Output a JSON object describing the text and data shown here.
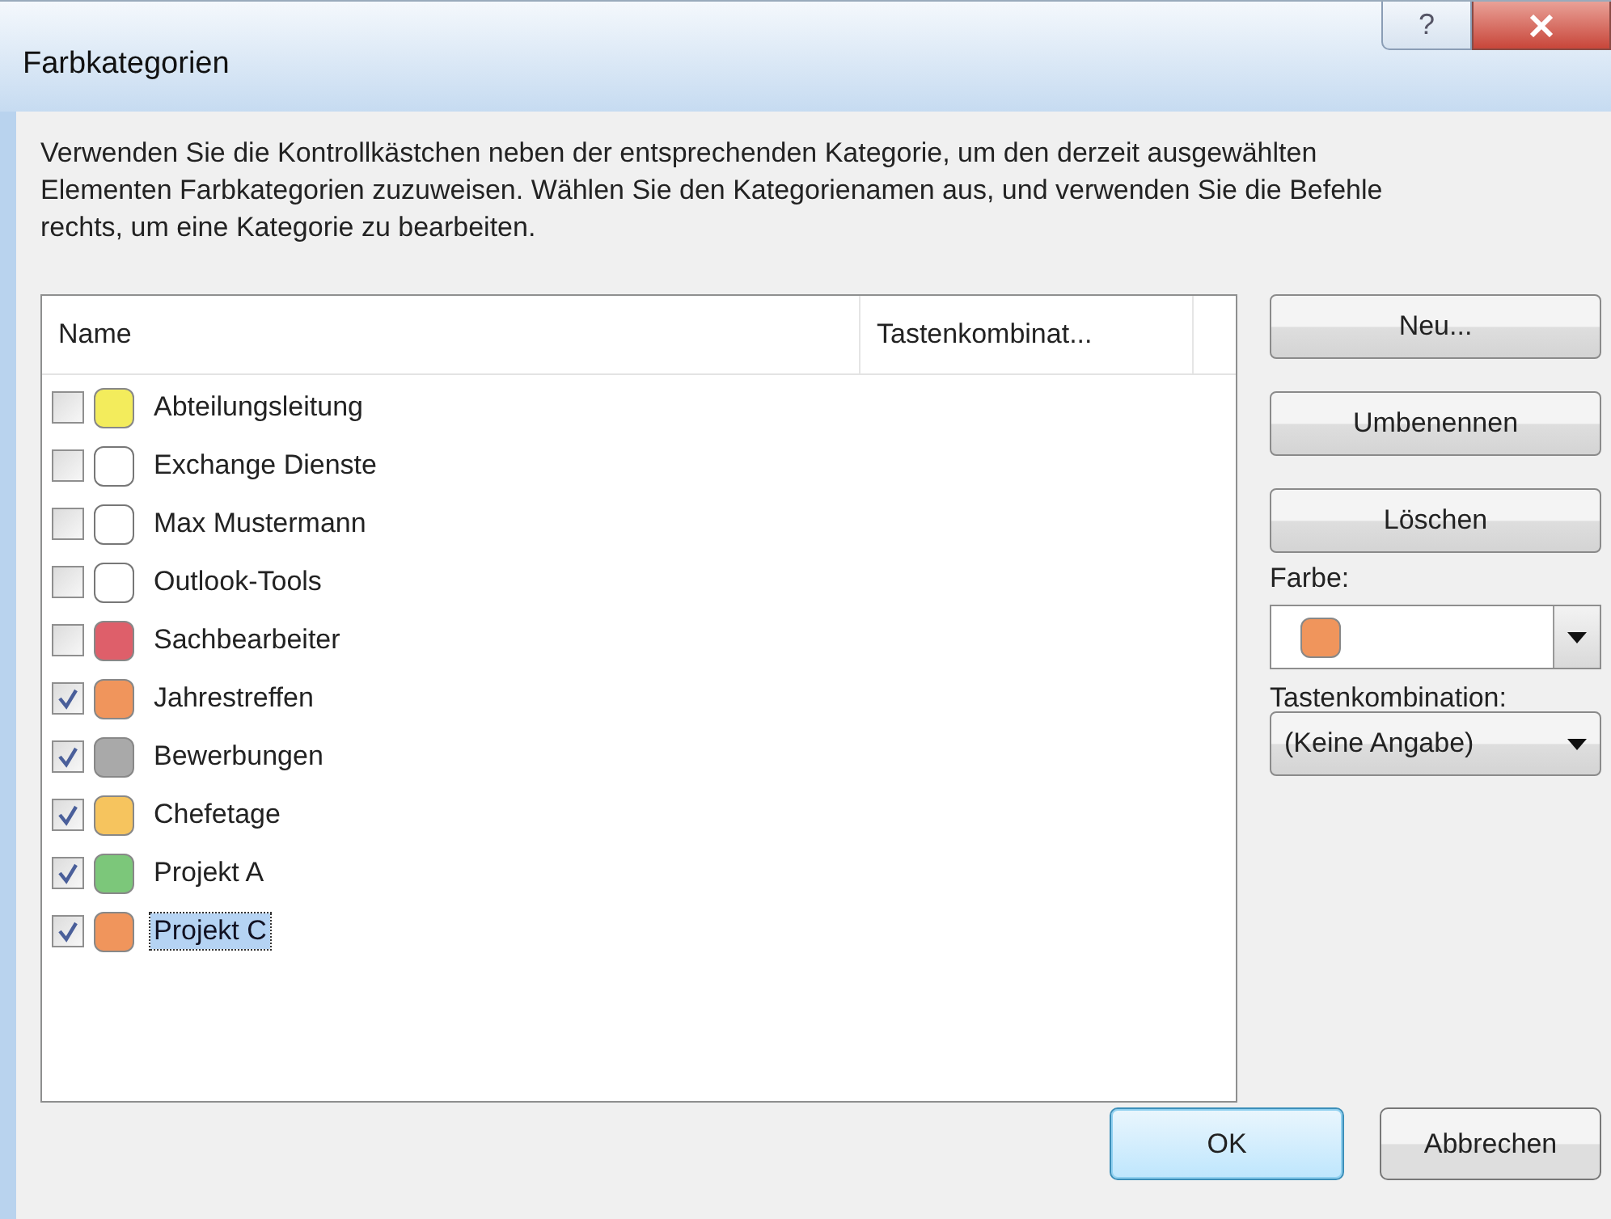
{
  "window": {
    "title": "Farbkategorien",
    "help_button": "?"
  },
  "description": "Verwenden Sie die Kontrollkästchen neben der entsprechenden Kategorie, um den derzeit ausgewählten Elementen Farbkategorien zuzuweisen. Wählen Sie den Kategorienamen aus, und verwenden Sie die Befehle rechts, um eine Kategorie zu bearbeiten.",
  "table": {
    "columns": [
      "Name",
      "Tastenkombinat..."
    ],
    "rows": [
      {
        "name": "Abteilungsleitung",
        "checked": false,
        "selected": false,
        "color": "#f3ec5c"
      },
      {
        "name": "Exchange Dienste",
        "checked": false,
        "selected": false
      },
      {
        "name": "Max Mustermann",
        "checked": false,
        "selected": false
      },
      {
        "name": "Outlook-Tools",
        "checked": false,
        "selected": false
      },
      {
        "name": "Sachbearbeiter",
        "checked": false,
        "selected": false,
        "color": "#de5f6a"
      },
      {
        "name": "Jahrestreffen",
        "checked": true,
        "selected": false,
        "color": "#f0955c"
      },
      {
        "name": "Bewerbungen",
        "checked": true,
        "selected": false,
        "color": "#a9a9a9"
      },
      {
        "name": "Chefetage",
        "checked": true,
        "selected": false,
        "color": "#f6c45e"
      },
      {
        "name": "Projekt A",
        "checked": true,
        "selected": false,
        "color": "#7cc77a"
      },
      {
        "name": "Projekt C",
        "checked": true,
        "selected": true,
        "color": "#f0955c"
      }
    ]
  },
  "side_buttons": [
    "Neu...",
    "Umbenennen",
    "Löschen"
  ],
  "color_field": {
    "label": "Farbe:",
    "color": "#f0955c"
  },
  "shortcut_field": {
    "label": "Tastenkombination:",
    "value": "(Keine Angabe)"
  },
  "buttons": [
    {
      "label": "OK",
      "default": true
    },
    {
      "label": "Abbrechen",
      "default": false
    }
  ]
}
